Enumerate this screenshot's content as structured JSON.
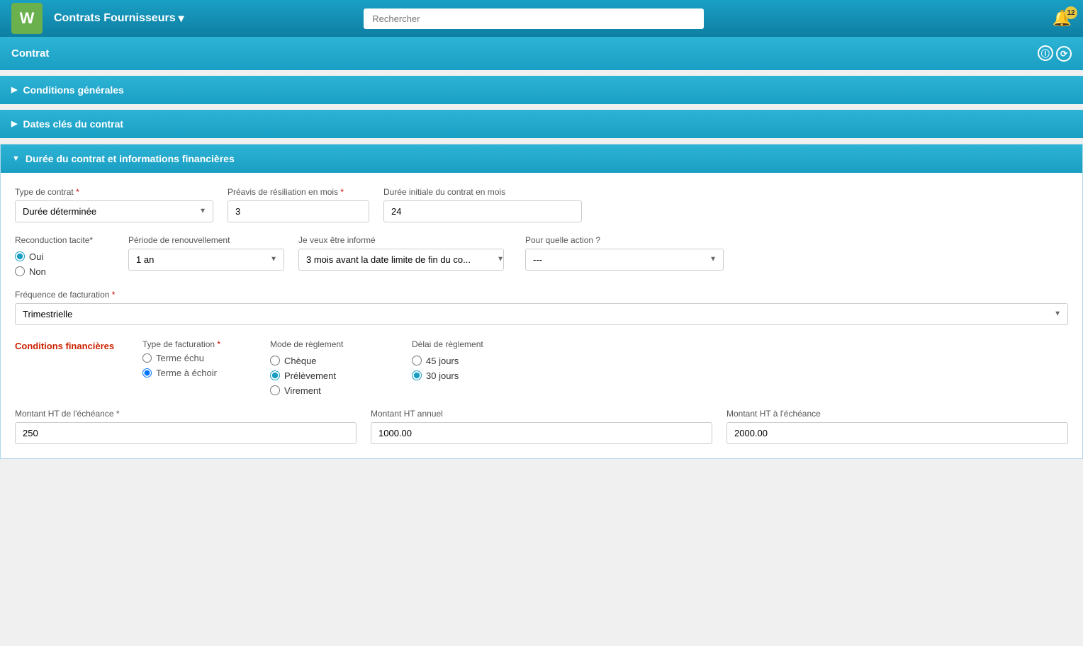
{
  "app": {
    "logo": "W",
    "title": "Contrats Fournisseurs",
    "title_arrow": "▾",
    "search_placeholder": "Rechercher",
    "notification_count": "12"
  },
  "contrat_header": {
    "title": "Contrat",
    "icon_info": "ⓘ",
    "icon_history": "⟳"
  },
  "sections": {
    "conditions_generales": "Conditions générales",
    "dates_cles": "Dates clés du contrat",
    "duree": "Durée du contrat et informations financières"
  },
  "form": {
    "type_contrat_label": "Type de contrat",
    "type_contrat_value": "Durée déterminée",
    "preavis_label": "Préavis de résiliation en mois",
    "preavis_value": "3",
    "duree_initiale_label": "Durée initiale du contrat en mois",
    "duree_initiale_value": "24",
    "reconduction_label": "Reconduction tacite*",
    "oui_label": "Oui",
    "non_label": "Non",
    "periode_label": "Période de renouvellement",
    "periode_value": "1 an",
    "inform_label": "Je veux être informé",
    "inform_value": "3 mois avant la date limite de fin du co...",
    "action_label": "Pour quelle action ?",
    "action_value": "---",
    "frequence_label": "Fréquence de facturation",
    "frequence_value": "Trimestrielle",
    "conditions_financieres_label": "Conditions financières",
    "type_facturation_label": "Type de facturation",
    "terme_echu_label": "Terme échu",
    "terme_echoir_label": "Terme à échoir",
    "mode_reglement_label": "Mode de règlement",
    "cheque_label": "Chèque",
    "prelevement_label": "Prélèvement",
    "virement_label": "Virement",
    "delai_reglement_label": "Délai de règlement",
    "jours_45_label": "45 jours",
    "jours_30_label": "30 jours",
    "montant_ht_echeance_label": "Montant HT de l'échéance",
    "montant_ht_echeance_value": "250",
    "montant_ht_annuel_label": "Montant HT annuel",
    "montant_ht_annuel_value": "1000.00",
    "montant_ht_label": "Montant HT à l'échéance",
    "montant_ht_value": "2000.00"
  }
}
